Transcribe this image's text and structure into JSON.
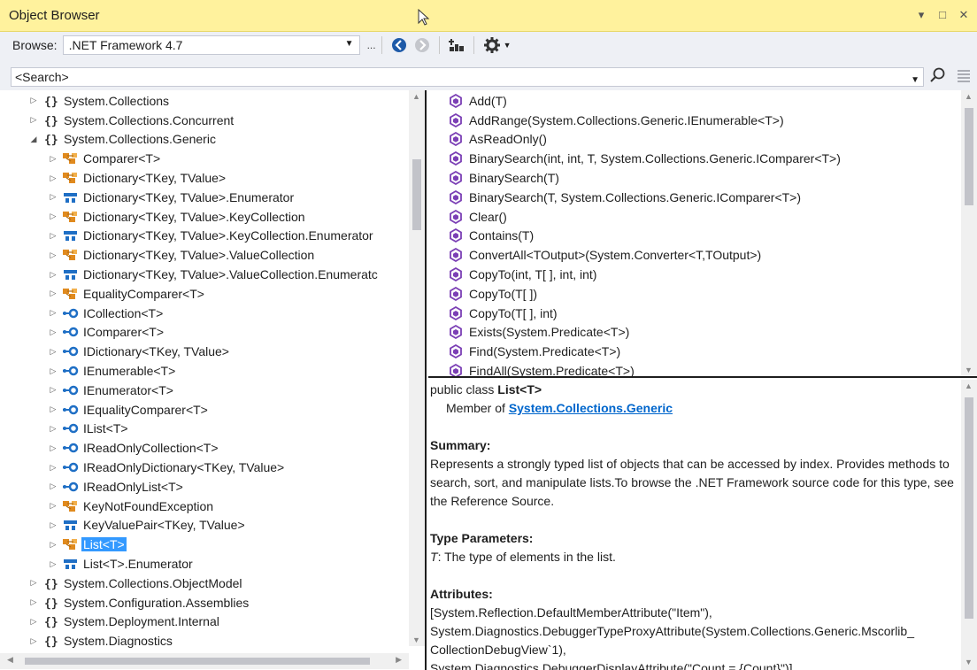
{
  "window": {
    "title": "Object Browser",
    "controls": [
      "▾",
      "□",
      "✕"
    ]
  },
  "toolbar": {
    "browse_label": "Browse:",
    "browse_value": ".NET Framework 4.7",
    "ellipsis": "..."
  },
  "search": {
    "value": "<Search>"
  },
  "tree": {
    "items": [
      {
        "level": 0,
        "expander": "closed",
        "icon": "namespace-icon",
        "label": "System.Collections"
      },
      {
        "level": 0,
        "expander": "closed",
        "icon": "namespace-icon",
        "label": "System.Collections.Concurrent"
      },
      {
        "level": 0,
        "expander": "open",
        "icon": "namespace-icon",
        "label": "System.Collections.Generic"
      },
      {
        "level": 1,
        "expander": "closed",
        "icon": "class-icon",
        "label": "Comparer<T>"
      },
      {
        "level": 1,
        "expander": "closed",
        "icon": "class-icon",
        "label": "Dictionary<TKey, TValue>"
      },
      {
        "level": 1,
        "expander": "closed",
        "icon": "struct-icon",
        "label": "Dictionary<TKey, TValue>.Enumerator"
      },
      {
        "level": 1,
        "expander": "closed",
        "icon": "class-icon",
        "label": "Dictionary<TKey, TValue>.KeyCollection"
      },
      {
        "level": 1,
        "expander": "closed",
        "icon": "struct-icon",
        "label": "Dictionary<TKey, TValue>.KeyCollection.Enumerator"
      },
      {
        "level": 1,
        "expander": "closed",
        "icon": "class-icon",
        "label": "Dictionary<TKey, TValue>.ValueCollection"
      },
      {
        "level": 1,
        "expander": "closed",
        "icon": "struct-icon",
        "label": "Dictionary<TKey, TValue>.ValueCollection.Enumeratc"
      },
      {
        "level": 1,
        "expander": "closed",
        "icon": "class-icon",
        "label": "EqualityComparer<T>"
      },
      {
        "level": 1,
        "expander": "closed",
        "icon": "interface-icon",
        "label": "ICollection<T>"
      },
      {
        "level": 1,
        "expander": "closed",
        "icon": "interface-icon",
        "label": "IComparer<T>"
      },
      {
        "level": 1,
        "expander": "closed",
        "icon": "interface-icon",
        "label": "IDictionary<TKey, TValue>"
      },
      {
        "level": 1,
        "expander": "closed",
        "icon": "interface-icon",
        "label": "IEnumerable<T>"
      },
      {
        "level": 1,
        "expander": "closed",
        "icon": "interface-icon",
        "label": "IEnumerator<T>"
      },
      {
        "level": 1,
        "expander": "closed",
        "icon": "interface-icon",
        "label": "IEqualityComparer<T>"
      },
      {
        "level": 1,
        "expander": "closed",
        "icon": "interface-icon",
        "label": "IList<T>"
      },
      {
        "level": 1,
        "expander": "closed",
        "icon": "interface-icon",
        "label": "IReadOnlyCollection<T>"
      },
      {
        "level": 1,
        "expander": "closed",
        "icon": "interface-icon",
        "label": "IReadOnlyDictionary<TKey, TValue>"
      },
      {
        "level": 1,
        "expander": "closed",
        "icon": "interface-icon",
        "label": "IReadOnlyList<T>"
      },
      {
        "level": 1,
        "expander": "closed",
        "icon": "class-icon",
        "label": "KeyNotFoundException"
      },
      {
        "level": 1,
        "expander": "closed",
        "icon": "struct-icon",
        "label": "KeyValuePair<TKey, TValue>"
      },
      {
        "level": 1,
        "expander": "closed",
        "icon": "class-icon",
        "label": "List<T>",
        "selected": true
      },
      {
        "level": 1,
        "expander": "closed",
        "icon": "struct-icon",
        "label": "List<T>.Enumerator"
      },
      {
        "level": 0,
        "expander": "closed",
        "icon": "namespace-icon",
        "label": "System.Collections.ObjectModel"
      },
      {
        "level": 0,
        "expander": "closed",
        "icon": "namespace-icon",
        "label": "System.Configuration.Assemblies"
      },
      {
        "level": 0,
        "expander": "closed",
        "icon": "namespace-icon",
        "label": "System.Deployment.Internal"
      },
      {
        "level": 0,
        "expander": "closed",
        "icon": "namespace-icon",
        "label": "System.Diagnostics"
      }
    ]
  },
  "members": {
    "items": [
      "Add(T)",
      "AddRange(System.Collections.Generic.IEnumerable<T>)",
      "AsReadOnly()",
      "BinarySearch(int, int, T, System.Collections.Generic.IComparer<T>)",
      "BinarySearch(T)",
      "BinarySearch(T, System.Collections.Generic.IComparer<T>)",
      "Clear()",
      "Contains(T)",
      "ConvertAll<TOutput>(System.Converter<T,TOutput>)",
      "CopyTo(int, T[ ], int, int)",
      "CopyTo(T[ ])",
      "CopyTo(T[ ], int)",
      "Exists(System.Predicate<T>)",
      "Find(System.Predicate<T>)",
      "FindAll(System.Predicate<T>)"
    ]
  },
  "description": {
    "decl_prefix": "public class ",
    "decl_name": "List<T>",
    "member_of_prefix": "Member of ",
    "member_of_link": "System.Collections.Generic",
    "summary_heading": "Summary:",
    "summary_text": "Represents a strongly typed list of objects that can be accessed by index. Provides methods to search, sort, and manipulate lists.To browse the .NET Framework source code for this type, see the Reference Source.",
    "type_params_heading": "Type Parameters:",
    "type_param_name": "T",
    "type_param_text": ": The type of elements in the list.",
    "attributes_heading": "Attributes:",
    "attr_line1": "[System.Reflection.DefaultMemberAttribute(\"Item\"),",
    "attr_line2": "System.Diagnostics.DebuggerTypeProxyAttribute(System.Collections.Generic.Mscorlib_",
    "attr_line3": "CollectionDebugView`1),",
    "attr_line4": "System.Diagnostics.DebuggerDisplayAttribute(\"Count = {Count}\")]"
  },
  "colors": {
    "titlebar": "#fff29d",
    "toolbar": "#eef0f5",
    "selection": "#3399ff",
    "link": "#0066cc",
    "class_icon": "#e08a1e",
    "struct_icon": "#1f6fc5",
    "interface_icon": "#1f6fc5",
    "method_icon": "#7b3fb5"
  }
}
